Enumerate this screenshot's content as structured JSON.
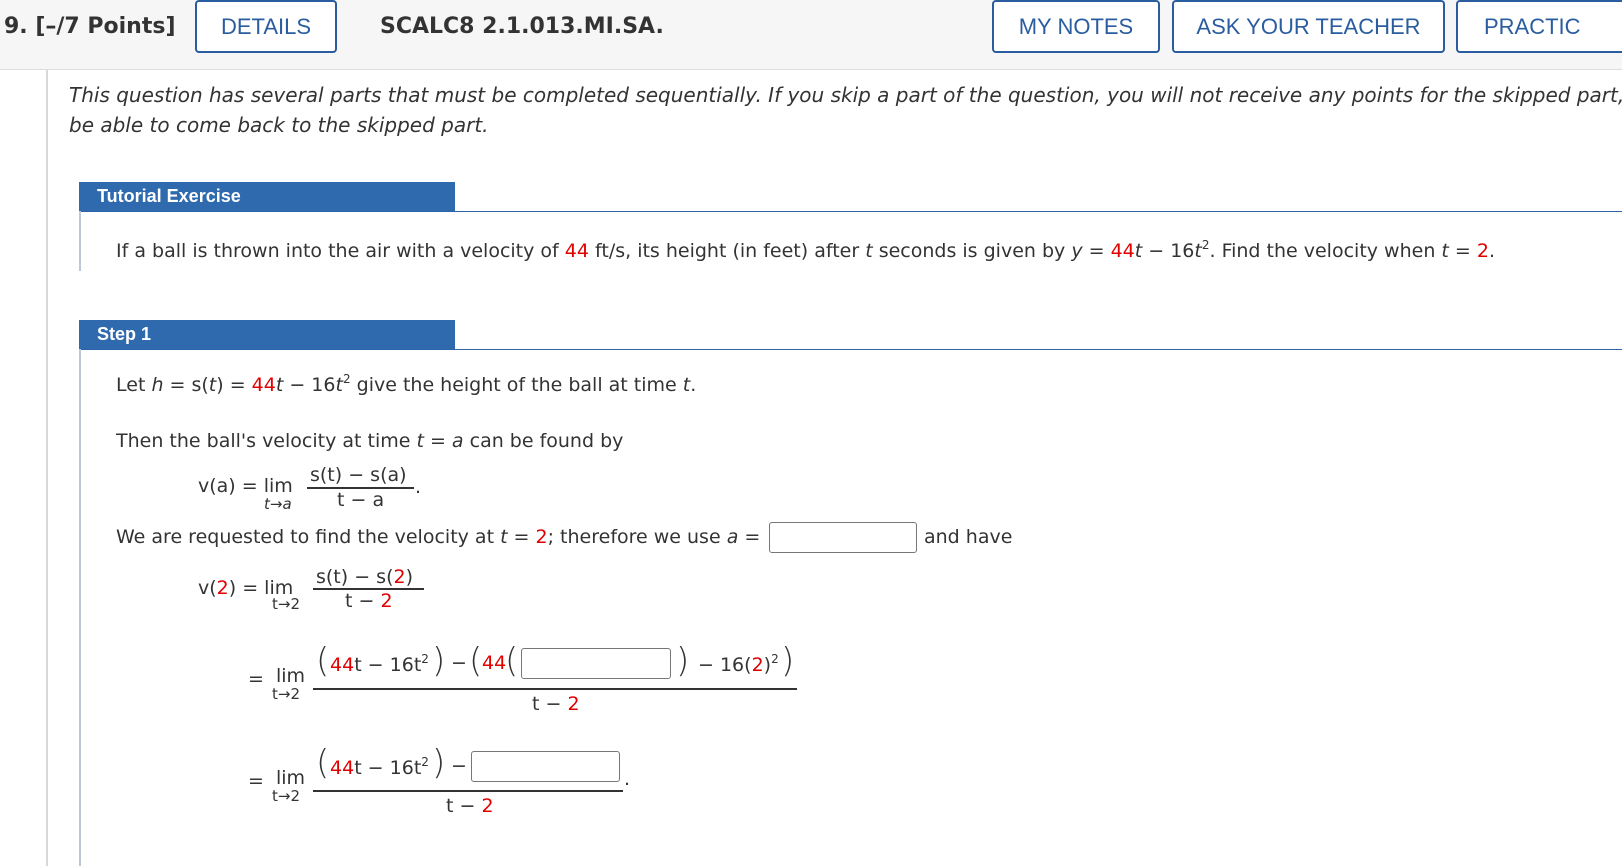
{
  "header": {
    "question_number": "9.",
    "points": "[–/7 Points]",
    "details_label": "DETAILS",
    "problem_code": "SCALC8 2.1.013.MI.SA.",
    "my_notes_label": "MY NOTES",
    "ask_teacher_label": "ASK YOUR TEACHER",
    "practice_label": "PRACTIC"
  },
  "intro": {
    "line1": "This question has several parts that must be completed sequentially. If you skip a part of the question, you will not receive any points for the skipped part, an",
    "line2": "be able to come back to the skipped part."
  },
  "tutorial": {
    "heading": "Tutorial Exercise",
    "p1": "If a ball is thrown into the air with a velocity of ",
    "v": "44",
    "p2": " ft/s, its height (in feet) after ",
    "t": "t",
    "p3": " seconds is given by ",
    "y": "y",
    "eq": " = ",
    "c1": "44",
    "t2": "t",
    "minus": " − 16",
    "t3": "t",
    "exp": "2",
    "p4": ". Find the velocity when ",
    "t4": "t",
    "p5": " = ",
    "tval": "2",
    "p6": "."
  },
  "step1": {
    "heading": "Step 1",
    "let_a": "Let ",
    "h": "h",
    "let_b": " = s(",
    "tv": "t",
    "let_c": ") = ",
    "c44": "44",
    "t5": "t",
    "let_d": " − 16",
    "t6": "t",
    "exp": "2",
    "let_e": "  give the height of the ball at time ",
    "t7": "t",
    "let_f": ".",
    "then_a": "Then the ball's velocity at time ",
    "then_t": "t",
    "then_b": " = ",
    "then_a2": "a",
    "then_c": " can be found by",
    "va": "v(a)  =  lim",
    "lim_sub_a": "t→a",
    "num_a": "s(t) − s(a)",
    "den_a": "t − a",
    "dot": ".",
    "req_a": "We are requested to find the velocity at ",
    "req_t": "t",
    "req_b": " = ",
    "req_2": "2",
    "req_c": "; therefore we use ",
    "req_a2": "a",
    "req_d": " =",
    "and_have": "and have",
    "v2_label_a": "v(",
    "v2_two": "2",
    "v2_label_b": ")  =  lim",
    "lim_sub_2": "t→2",
    "num_2a": "s(t) − s(",
    "num_2b": "2",
    "num_2c": ")",
    "den_2a": "t − ",
    "den_2b": "2",
    "eq": "=",
    "lim": "lim",
    "r2_44": "44",
    "r2_t": "t − 16t",
    "r2_exp": "2",
    "r2_minus": "−",
    "r2_44b": "44",
    "r2_tail_a": "− 16(",
    "r2_tail_2": "2",
    "r2_tail_b": ")",
    "r2_tail_exp": "2",
    "r3_dot": "."
  }
}
